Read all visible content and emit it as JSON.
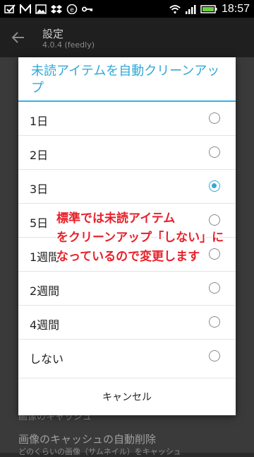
{
  "status_bar": {
    "time": "18:57",
    "left_icons": [
      "checkbox-icon",
      "m-logo-icon",
      "image-icon",
      "dropbox-icon",
      "e-badge-icon",
      "key-icon"
    ],
    "right_icons": [
      "wifi-icon",
      "signal-icon",
      "battery-icon"
    ]
  },
  "app_bar": {
    "title": "設定",
    "subtitle": "4.0.4 (feedly)"
  },
  "background": {
    "item1": "画像のキャッシュ",
    "item2": "画像のキャッシュの自動削除",
    "item3": "どのくらいの画像（サムネイル）をキャッシュ"
  },
  "dialog": {
    "title": "未読アイテムを自動クリーンアップ",
    "options": [
      {
        "label": "1日",
        "selected": false
      },
      {
        "label": "2日",
        "selected": false
      },
      {
        "label": "3日",
        "selected": true
      },
      {
        "label": "5日",
        "selected": false
      },
      {
        "label": "1週間",
        "selected": false
      },
      {
        "label": "2週間",
        "selected": false
      },
      {
        "label": "4週間",
        "selected": false
      },
      {
        "label": "しない",
        "selected": false
      }
    ],
    "cancel_label": "キャンセル",
    "accent_color": "#33b5e5"
  },
  "annotation": {
    "lines": [
      "標準では未読アイテム",
      "をクリーンアップ「しない」に",
      "なっているので変更します"
    ],
    "color": "#e8212b"
  }
}
